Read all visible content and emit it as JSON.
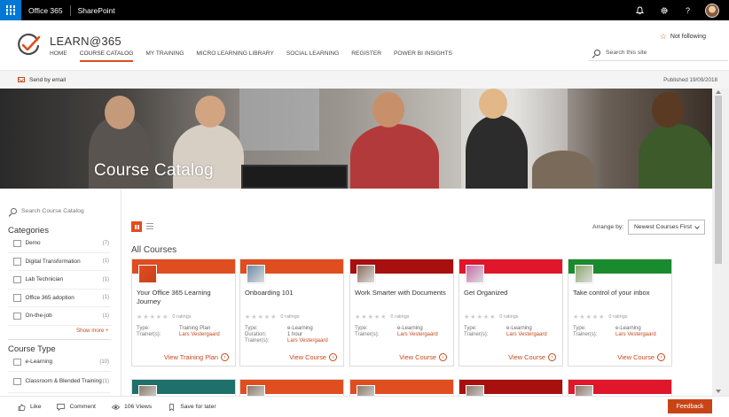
{
  "suite": {
    "app_name": "Office 365",
    "product": "SharePoint"
  },
  "site": {
    "title": "LEARN@365",
    "follow": "Not following",
    "search_placeholder": "Search this site",
    "nav": [
      {
        "label": "HOME",
        "active": false
      },
      {
        "label": "COURSE CATALOG",
        "active": true
      },
      {
        "label": "MY TRAINING",
        "active": false
      },
      {
        "label": "MICRO LEARNING LIBRARY",
        "active": false
      },
      {
        "label": "SOCIAL LEARNING",
        "active": false
      },
      {
        "label": "REGISTER",
        "active": false
      },
      {
        "label": "POWER BI INSIGHTS",
        "active": false
      }
    ]
  },
  "command_bar": {
    "send_email": "Send by email",
    "published": "Published 19/09/2018"
  },
  "hero": {
    "title": "Course Catalog"
  },
  "filters": {
    "search_placeholder": "Search Course Catalog",
    "categories_title": "Categories",
    "categories": [
      {
        "label": "Demo",
        "count": "(7)"
      },
      {
        "label": "Digital Transformation",
        "count": "(1)"
      },
      {
        "label": "Lab Technician",
        "count": "(1)"
      },
      {
        "label": "Office 365 adoption",
        "count": "(1)"
      },
      {
        "label": "On-the-job",
        "count": "(1)"
      }
    ],
    "show_more": "Show more +",
    "course_type_title": "Course Type",
    "course_types": [
      {
        "label": "e-Learning",
        "count": "(10)"
      },
      {
        "label": "Classroom & Blended Training",
        "count": "(1)"
      }
    ]
  },
  "main": {
    "arrange_label": "Arrange by:",
    "arrange_value": "Newest Courses First",
    "section_title": "All Courses",
    "courses": [
      {
        "title": "Your Office 365 Learning Journey",
        "ratings": "0 ratings",
        "band_color": "#e04d1f",
        "meta": [
          {
            "k": "Type:",
            "v": "Training Plan",
            "link": false
          },
          {
            "k": "Trainer(s):",
            "v": "Lars Vestergaard",
            "link": true
          }
        ],
        "cta": "View Training Plan"
      },
      {
        "title": "Onboarding 101",
        "ratings": "0 ratings",
        "band_color": "#e04d1f",
        "meta": [
          {
            "k": "Type:",
            "v": "e-Learning",
            "link": false
          },
          {
            "k": "Duration:",
            "v": "1 hour",
            "link": false
          },
          {
            "k": "Trainer(s):",
            "v": "Lars Vestergaard",
            "link": true
          }
        ],
        "cta": "View Course"
      },
      {
        "title": "Work Smarter with Documents",
        "ratings": "0 ratings",
        "band_color": "#a80f0f",
        "meta": [
          {
            "k": "Type:",
            "v": "e-Learning",
            "link": false
          },
          {
            "k": "Trainer(s):",
            "v": "Lars Vestergaard",
            "link": true
          }
        ],
        "cta": "View Course"
      },
      {
        "title": "Get Organized",
        "ratings": "0 ratings",
        "band_color": "#e0162b",
        "meta": [
          {
            "k": "Type:",
            "v": "e-Learning",
            "link": false
          },
          {
            "k": "Trainer(s):",
            "v": "Lars Vestergaard",
            "link": true
          }
        ],
        "cta": "View Course"
      },
      {
        "title": "Take control of your inbox",
        "ratings": "0 ratings",
        "band_color": "#1a8a2e",
        "meta": [
          {
            "k": "Type:",
            "v": "e-Learning",
            "link": false
          },
          {
            "k": "Trainer(s):",
            "v": "Lars Vestergaard",
            "link": true
          }
        ],
        "cta": "View Course"
      }
    ],
    "second_row_colors": [
      "#1f6f6a",
      "#e04d1f",
      "#e04d1f",
      "#a80f0f",
      "#e0162b"
    ]
  },
  "footer": {
    "like": "Like",
    "comment": "Comment",
    "views": "106 Views",
    "save": "Save for later",
    "feedback": "Feedback"
  }
}
